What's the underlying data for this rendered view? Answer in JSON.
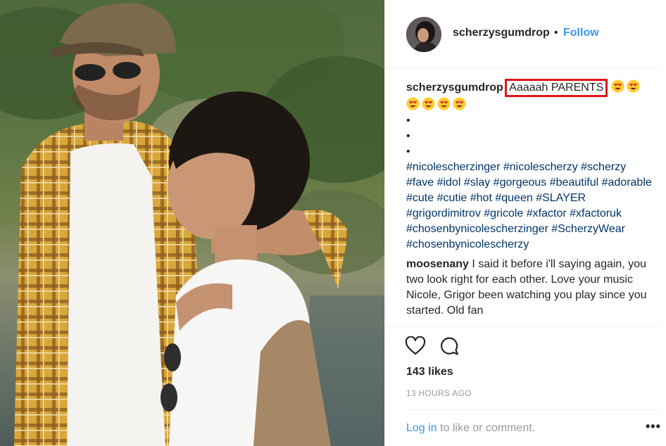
{
  "post": {
    "username": "scherzysgumdrop",
    "dot": "•",
    "follow_label": "Follow",
    "caption": {
      "username": "scherzysgumdrop",
      "text": "Aaaaah PARENTS",
      "bullets": [
        "•",
        "•",
        "•"
      ],
      "hashtags": [
        "#nicolescherzinger",
        "#nicolescherzy",
        "#scherzy",
        "#fave",
        "#idol",
        "#slay",
        "#gorgeous",
        "#beautiful",
        "#adorable",
        "#cute",
        "#cutie",
        "#hot",
        "#queen",
        "#SLAYER",
        "#grigordimitrov",
        "#gricole",
        "#xfactor",
        "#xfactoruk",
        "#chosenbynicolescherzinger",
        "#ScherzyWear",
        "#chosenbynicolescherzy"
      ]
    },
    "comment": {
      "username": "moosenany",
      "text": "I said it before i'll saying again, you two look right for each other. Love your music Nicole, Grigor been watching you play since you started. Old fan"
    },
    "likes": "143 likes",
    "time": "13 HOURS AGO",
    "login": {
      "link": "Log in",
      "rest": " to like or comment."
    },
    "more": "•••"
  },
  "colors": {
    "link_blue": "#3897f0",
    "hashtag_blue": "#003569",
    "highlight_red": "#e0151b",
    "muted_grey": "#999999"
  },
  "icons": [
    "heart-icon",
    "comment-icon",
    "heart-eyes-emoji",
    "more-icon"
  ]
}
